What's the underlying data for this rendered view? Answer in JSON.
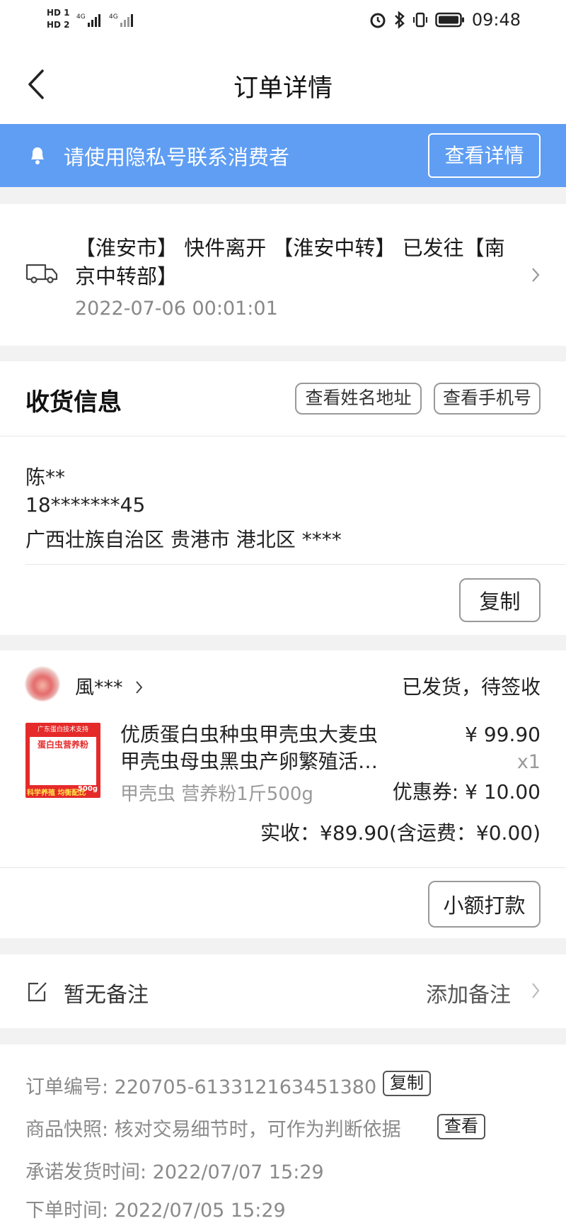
{
  "status_bar": {
    "hd1": "HD 1",
    "hd2": "HD 2",
    "net1": "4G",
    "net2": "4G",
    "time": "09:48"
  },
  "header": {
    "title": "订单详情"
  },
  "notice": {
    "text": "请使用隐私号联系消费者",
    "button": "查看详情"
  },
  "logistics": {
    "text": "【淮安市】 快件离开 【淮安中转】 已发往【南京中转部】",
    "time": "2022-07-06 00:01:01"
  },
  "receiver": {
    "title": "收货信息",
    "view_name_button": "查看姓名地址",
    "view_phone_button": "查看手机号",
    "name": "陈**",
    "phone": "18*******45",
    "address": "广西壮族自治区 贵港市 港北区 ****",
    "copy_button": "复制"
  },
  "order_item": {
    "shop": "風***",
    "status": "已发货，待签收",
    "thumb_lines": [
      "广东蛋白技术支持",
      "蛋白虫营养粉",
      "科学养殖 均衡配比",
      "500g"
    ],
    "name": "优质蛋白虫种虫甲壳虫大麦虫甲壳虫母虫黑虫产卵繁殖活…",
    "spec": "甲壳虫 营养粉1斤500g",
    "price": "¥ 99.90",
    "qty": "x1",
    "coupon": "优惠券: ¥ 10.00",
    "paid": "实收：¥89.90(含运费：¥0.00)",
    "small_pay_button": "小额打款"
  },
  "remark": {
    "text": "暂无备注",
    "add": "添加备注"
  },
  "order_info": {
    "order_no_label": "订单编号: 220705-613312163451380",
    "copy": "复制",
    "snapshot_label": "商品快照: 核对交易细节时，可作为判断依据",
    "view": "查看",
    "ship_time": "承诺发货时间: 2022/07/07 15:29",
    "order_time": "下单时间: 2022/07/05 15:29"
  }
}
